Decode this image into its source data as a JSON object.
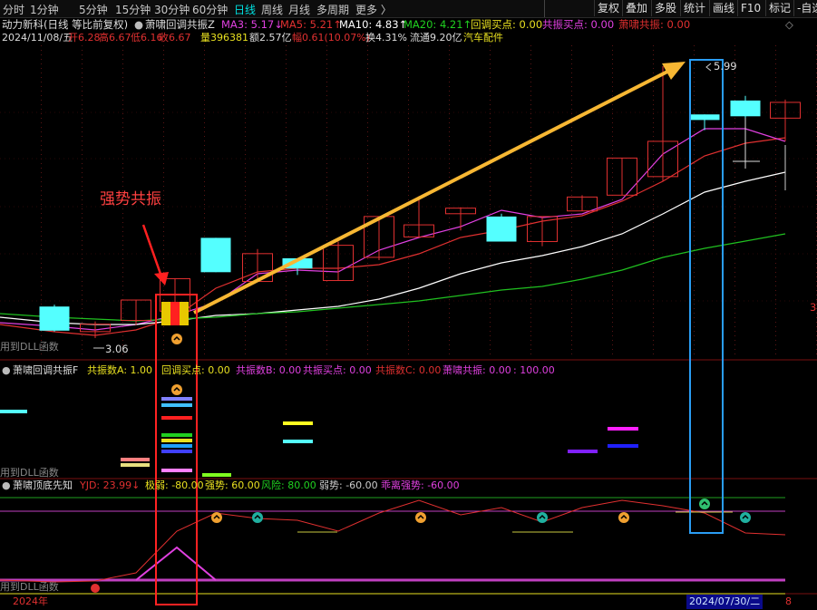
{
  "toolbar": {
    "periods": [
      "分时",
      "1分钟",
      "5分钟",
      "15分钟",
      "30分钟",
      "60分钟",
      "日线",
      "周线",
      "月线",
      "多周期",
      "更多 〉"
    ],
    "active_period": "日线",
    "buttons": [
      "复权",
      "叠加",
      "多股",
      "统计",
      "画线",
      "F10",
      "标记",
      "-自选"
    ]
  },
  "main": {
    "stock_title": "动力新科(日线 等比前复权)",
    "indicator_name": "萧啸回调共振Z",
    "ma3": "MA3: 5.17↓",
    "ma5": "MA5: 5.21↑",
    "ma10": "MA10: 4.83↑",
    "ma20": "MA20: 4.21↑",
    "pullback_buy": "回调买点: 0.00",
    "resonance_buy": "共振买点: 0.00",
    "xiaoxiao_resonance": "萧啸共振: 0.00",
    "date": "2024/11/08/五",
    "open": "开6.28",
    "high": "高6.67",
    "low": "低6.16",
    "close": "收6.67",
    "volume": "量396381",
    "amount": "额2.57亿",
    "change": "幅0.61(10.07%)",
    "turnover": "换4.31%",
    "float_cap": "流通9.20亿",
    "sector": "汽车配件",
    "high_label": "5.99",
    "low_label": "3.06",
    "right_axis_label": "3",
    "annotation": "强势共振",
    "dll_note_1": "用到DLL函数"
  },
  "sub1": {
    "name": "萧啸回调共振F",
    "count_a": "共振数A: 1.00",
    "pullback_buy": "回调买点: 0.00",
    "count_b": "共振数B: 0.00",
    "resonance_buy": "共振买点: 0.00",
    "count_c": "共振数C: 0.00",
    "xiaoxiao_resonance": "萧啸共振: 0.00",
    "value_100": ": 100.00",
    "dll_note": "用到DLL函数"
  },
  "sub2": {
    "name": "萧啸顶底先知",
    "yjd": "YJD: 23.99↓",
    "extreme_weak": "极弱: -80.00",
    "strong": "强势: 60.00",
    "risk": "风险: 80.00",
    "weak": "弱势: -60.00",
    "divergence": "乖离强势: -60.00",
    "dll_note": "用到DLL函数"
  },
  "footer": {
    "year": "2024年",
    "date_box": "2024/07/30/二",
    "right_num": "8"
  },
  "colors": {
    "up": "#e03030",
    "down": "#54ffff",
    "ma5": "#e040e0",
    "ma10": "#ffffff",
    "ma20": "#e03030",
    "ma60": "#20c020",
    "arrow": "#f7b733",
    "highlight_red": "#ff2222",
    "highlight_blue": "#2a9df4"
  },
  "candles": [
    {
      "o": 3.4,
      "h": 3.42,
      "l": 3.13,
      "c": 3.14
    },
    {
      "o": 3.13,
      "h": 3.24,
      "l": 3.06,
      "c": 3.21
    },
    {
      "o": 3.25,
      "h": 3.47,
      "l": 3.2,
      "c": 3.47
    },
    {
      "o": 3.35,
      "h": 3.7,
      "l": 3.3,
      "c": 3.7
    },
    {
      "o": 4.14,
      "h": 4.14,
      "l": 3.77,
      "c": 3.77
    },
    {
      "o": 3.67,
      "h": 4.02,
      "l": 3.67,
      "c": 3.97
    },
    {
      "o": 3.92,
      "h": 3.92,
      "l": 3.74,
      "c": 3.81
    },
    {
      "o": 3.68,
      "h": 4.1,
      "l": 3.68,
      "c": 4.06
    },
    {
      "o": 3.93,
      "h": 4.37,
      "l": 3.9,
      "c": 4.37
    },
    {
      "o": 4.15,
      "h": 4.59,
      "l": 4.15,
      "c": 4.28
    },
    {
      "o": 4.4,
      "h": 4.47,
      "l": 4.22,
      "c": 4.46
    },
    {
      "o": 4.37,
      "h": 4.4,
      "l": 4.1,
      "c": 4.1
    },
    {
      "o": 4.1,
      "h": 4.37,
      "l": 4.05,
      "c": 4.37
    },
    {
      "o": 4.43,
      "h": 4.6,
      "l": 4.43,
      "c": 4.58
    },
    {
      "o": 4.6,
      "h": 5.0,
      "l": 4.6,
      "c": 5.0
    },
    {
      "o": 4.8,
      "h": 5.99,
      "l": 4.75,
      "c": 5.18
    },
    {
      "o": 5.47,
      "h": 5.47,
      "l": 5.3,
      "c": 5.41
    },
    {
      "o": 5.62,
      "h": 5.67,
      "l": 5.2,
      "c": 5.45
    },
    {
      "o": 5.43,
      "h": 5.63,
      "l": 5.18,
      "c": 5.6
    }
  ]
}
